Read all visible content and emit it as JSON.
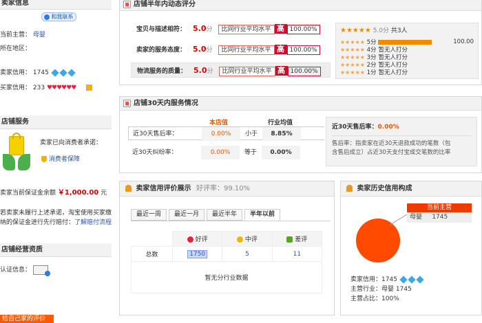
{
  "left": {
    "seller_info_header": "卖家信息",
    "contact_label": "和我联系",
    "main_business_label": "当前主营：",
    "main_business_value": "母婴",
    "location_label": "所在地区：",
    "seller_credit_label": "卖家信用：",
    "seller_credit_value": "1745",
    "buyer_credit_label": "买家信用：",
    "buyer_credit_value": "233",
    "shop_service_header": "店铺服务",
    "promise_text": "卖家已向消费者承诺：",
    "consumer_guard": "消费者保障",
    "deposit_label": "卖家当前保证金余额",
    "deposit_value": "￥1,000.00",
    "deposit_unit": "元",
    "deposit_note_1": "若卖家未履行上述承诺，淘宝使用买家缴",
    "deposit_note_2": "纳的保证金进行先行赔付：",
    "deposit_link": "了解赔付流程",
    "qualification_header": "店铺经营资质",
    "cert_label": "认证信息：",
    "bottom_button": "给自己家的评价"
  },
  "half_year": {
    "title": "店铺半年内动态评分",
    "rows": [
      {
        "label": "宝贝与描述相符：",
        "score": "5.0",
        "unit": "分",
        "compare": "比同行业平均水平",
        "hi": "高",
        "pct": "100.00%"
      },
      {
        "label": "卖家的服务态度：",
        "score": "5.0",
        "unit": "分",
        "compare": "比同行业平均水平",
        "hi": "高",
        "pct": "100.00%"
      },
      {
        "label": "物流服务的质量：",
        "score": "5.0",
        "unit": "分",
        "compare": "比同行业平均水平",
        "hi": "高",
        "pct": "100.00%"
      }
    ],
    "rating": {
      "summary_score": "5.0",
      "summary_unit": "分",
      "summary_count": "共3人",
      "bars": [
        {
          "label": "5分",
          "fill": 1.0,
          "value": "100.00"
        },
        {
          "label": "4分",
          "fill": 0,
          "value": "暂无人打分"
        },
        {
          "label": "3分",
          "fill": 0,
          "value": "暂无人打分"
        },
        {
          "label": "2分",
          "fill": 0,
          "value": "暂无人打分"
        },
        {
          "label": "1分",
          "fill": 0,
          "value": "暂无人打分"
        }
      ]
    }
  },
  "thirty_day": {
    "title": "店铺30天内服务情况",
    "col_shop": "本店值",
    "col_industry": "行业均值",
    "rows": [
      {
        "label": "近30天售后率：",
        "shop": "0.00%",
        "relation": "小于",
        "industry": "8.85%"
      },
      {
        "label": "近30天纠纷率：",
        "shop": "0.00%",
        "relation": "等于",
        "industry": "0.00%"
      }
    ],
    "side_title": "近30天售后率：",
    "side_value": "0.00%",
    "side_desc_1": "售后率：指卖家在近30天退款成功的笔数（包",
    "side_desc_2": "含售后成立）占近30天支付宝成交笔数的比率"
  },
  "credit": {
    "title": "卖家信用评价展示",
    "good_rate": "好评率：99.10%",
    "tabs": [
      "最近一周",
      "最近一月",
      "最近半年",
      "半年以前"
    ],
    "col_good": "好评",
    "col_mid": "中评",
    "col_bad": "差评",
    "row_label": "总数",
    "good": "1750",
    "mid": "5",
    "bad": "11",
    "no_data": "暂无分行业数据"
  },
  "history": {
    "title": "卖家历史信用构成",
    "tag": "当前主营",
    "tag_cat": "母婴",
    "tag_val": "1745",
    "credit_label": "卖家信用：",
    "credit_value": "1745",
    "industry_label": "主营行业：",
    "industry_cat": "母婴",
    "industry_value": "1745",
    "ratio_label": "主营占比：",
    "ratio_value": "100%",
    "pie_share": 1.0
  },
  "colors": {
    "accent": "#c8102e",
    "orange": "#ff5a00",
    "link": "#2a56a8"
  }
}
